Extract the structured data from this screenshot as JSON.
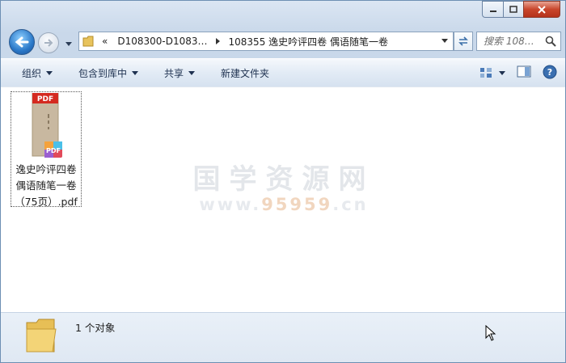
{
  "address": {
    "overflow": "«",
    "segment1": "D108300-D1083…",
    "segment2": "108355 逸史吟评四卷 偶语随笔一卷"
  },
  "search": {
    "placeholder": "搜索 108…"
  },
  "toolbar": {
    "organize": "组织",
    "include_in_library": "包含到库中",
    "share": "共享",
    "new_folder": "新建文件夹"
  },
  "file": {
    "badge": "PDF",
    "overlay_badge": "PDF",
    "name_line1": "逸史吟评四卷",
    "name_line2": "偶语随笔一卷",
    "name_line3": "（75页）.pdf"
  },
  "watermark": {
    "title": "国学资源网",
    "url_prefix": "www.",
    "url_highlight": "95959",
    "url_suffix": ".cn"
  },
  "status": {
    "text": "1 个对象"
  },
  "colors": {
    "accent": "#2a78c8",
    "close": "#c9462c",
    "pdf_red": "#d42a20"
  }
}
